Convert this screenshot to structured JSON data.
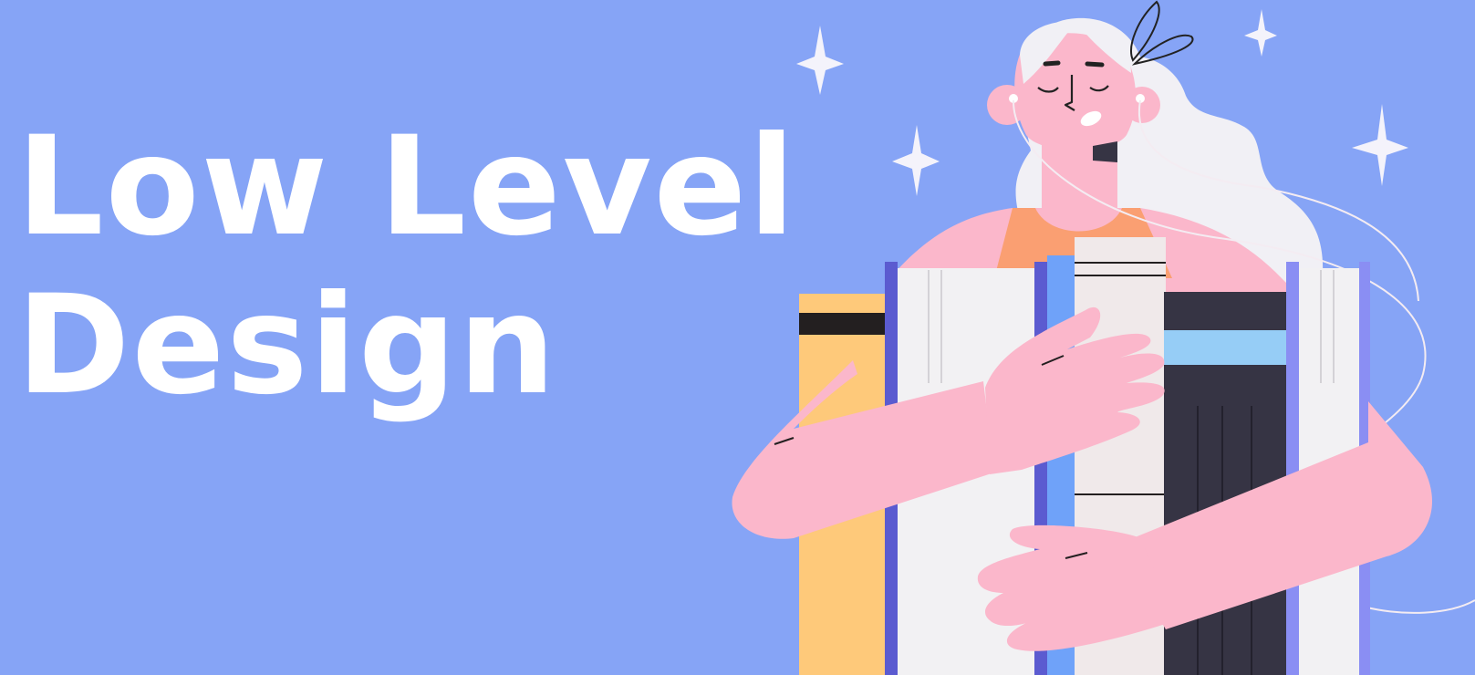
{
  "banner": {
    "title_line_1": "Low Level",
    "title_line_2": "Design"
  },
  "colors": {
    "background": "#86a4f6",
    "title_text": "#ffffff",
    "skin": "#fbb7cb",
    "hair": "#f1f0f5",
    "top": "#fa9f72",
    "book_yellow": "#fec97a",
    "book_white": "#f2f1f3",
    "book_dark": "#363444",
    "book_stripe_blue": "#96cdf6",
    "spine_purple": "#5b5bd0",
    "spine_blue": "#6fa2f9"
  },
  "icons": [
    "sparkle-icon",
    "earphones-icon",
    "hair-clip-icon"
  ]
}
